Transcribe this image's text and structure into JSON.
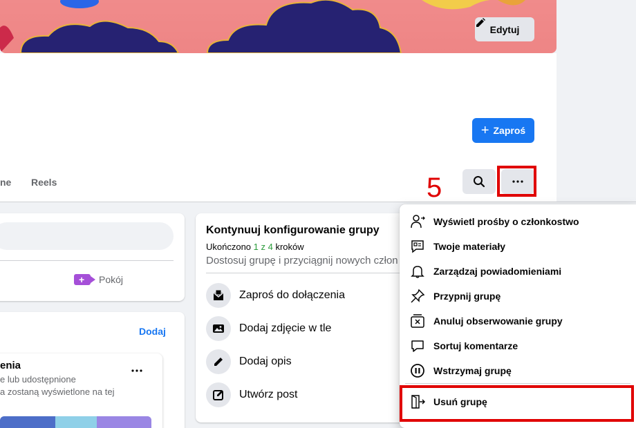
{
  "cover": {
    "edit_label": "Edytuj"
  },
  "header": {
    "invite_label": "Zaproś",
    "tabs": [
      "ne",
      "Reels"
    ]
  },
  "annotation": {
    "step_number": "5"
  },
  "composer": {
    "room_label": "Pokój"
  },
  "featured": {
    "add_label": "Dodaj",
    "title": "enia",
    "line1": "e lub udostępnione",
    "line2": "a zostaną wyświetlone na tej"
  },
  "setup": {
    "title": "Kontynuuj konfigurowanie grupy",
    "progress_prefix": "Ukończono ",
    "progress_count": "1 z 4",
    "progress_suffix": " kroków",
    "description": "Dostosuj grupę i przyciągnij nowych człon",
    "items": [
      {
        "label": "Zaproś do dołączenia",
        "icon": "envelope-icon"
      },
      {
        "label": "Dodaj zdjęcie w tle",
        "icon": "image-icon"
      },
      {
        "label": "Dodaj opis",
        "icon": "pencil-icon"
      },
      {
        "label": "Utwórz post",
        "icon": "compose-icon"
      }
    ]
  },
  "menu": {
    "items": [
      {
        "label": "Wyświetl prośby o członkostwo",
        "icon": "person-add-icon"
      },
      {
        "label": "Twoje materiały",
        "icon": "content-icon"
      },
      {
        "label": "Zarządzaj powiadomieniami",
        "icon": "bell-icon"
      },
      {
        "label": "Przypnij grupę",
        "icon": "pin-icon"
      },
      {
        "label": "Anuluj obserwowanie grupy",
        "icon": "unfollow-icon"
      },
      {
        "label": "Sortuj komentarze",
        "icon": "comment-icon"
      },
      {
        "label": "Wstrzymaj grupę",
        "icon": "pause-icon"
      },
      {
        "label": "Usuń grupę",
        "icon": "exit-door-icon"
      }
    ]
  },
  "colors": {
    "primary": "#1877f2",
    "highlight": "#e00000",
    "cover_bg": "#f08b8b",
    "cloud": "#262272"
  }
}
